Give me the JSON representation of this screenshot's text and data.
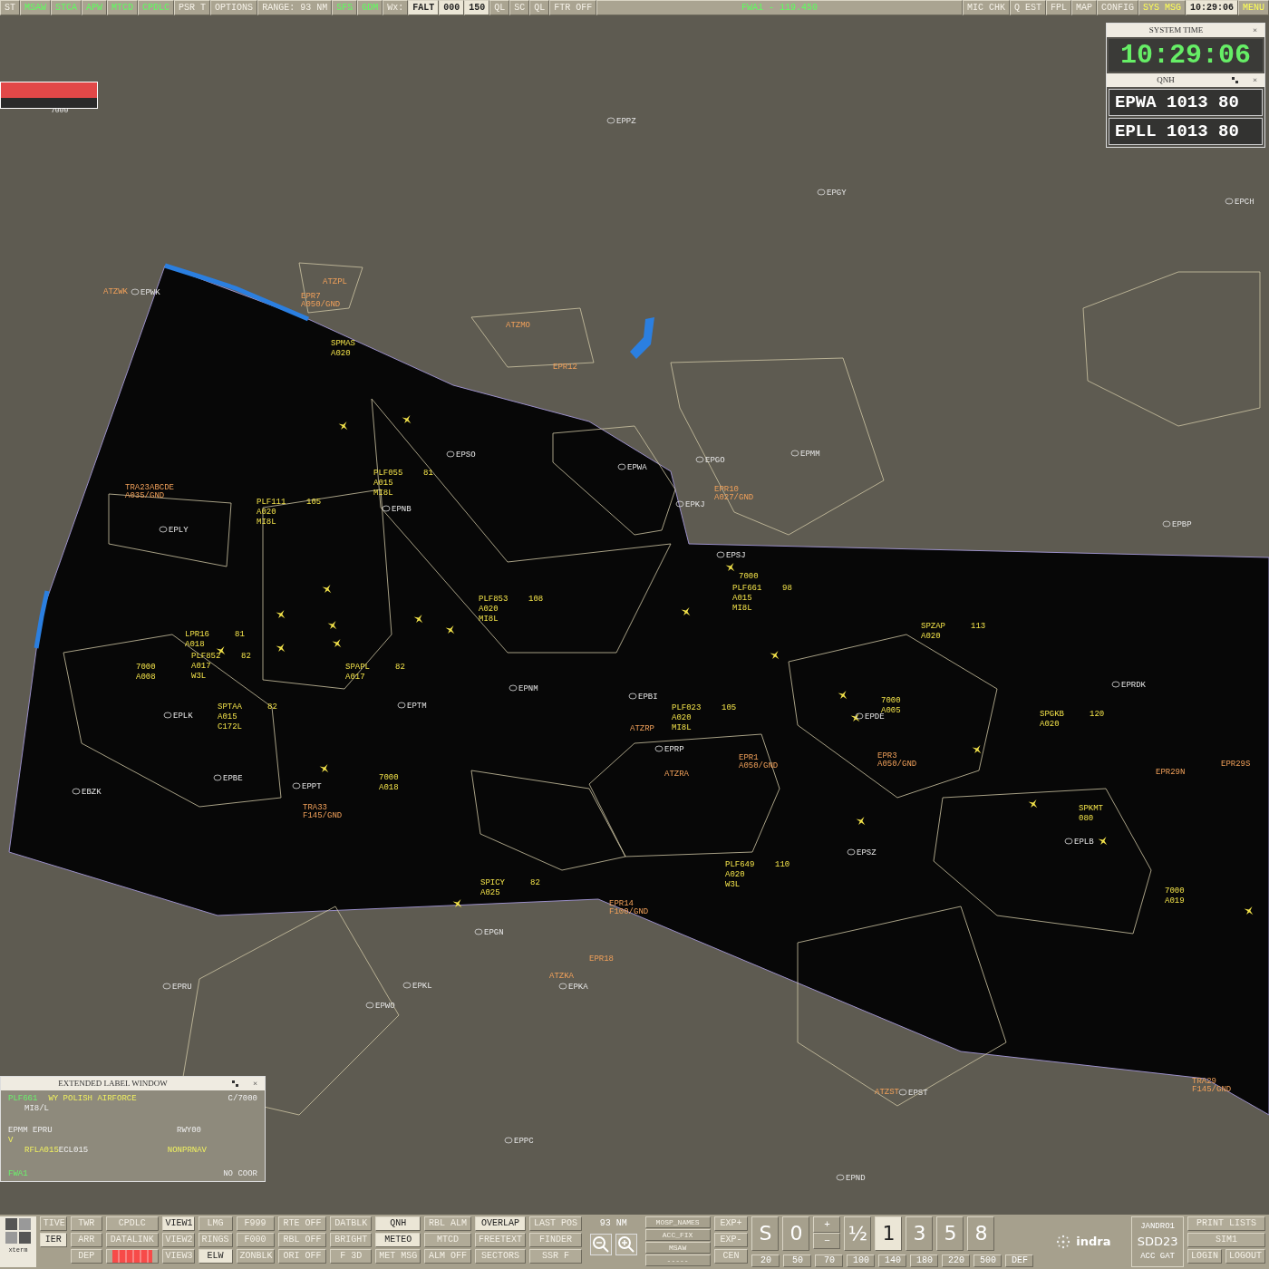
{
  "top_bar": [
    {
      "label": "ST",
      "kind": "plain"
    },
    {
      "label": "MSAW",
      "kind": "enabled"
    },
    {
      "label": "STCA",
      "kind": "enabled"
    },
    {
      "label": "APW",
      "kind": "enabled"
    },
    {
      "label": "MTCD",
      "kind": "enabled"
    },
    {
      "label": "CPDLC",
      "kind": "enabled"
    },
    {
      "label": "PSR T",
      "kind": "plain"
    },
    {
      "label": "OPTIONS",
      "kind": "plain"
    },
    {
      "label": "RANGE: 93 NM",
      "kind": "plain"
    },
    {
      "label": "SFS",
      "kind": "enabled"
    },
    {
      "label": "GDM",
      "kind": "enabled"
    },
    {
      "label": "Wx:",
      "kind": "plain"
    },
    {
      "label": "FALT",
      "kind": "pressed"
    },
    {
      "label": "000",
      "kind": "pressed"
    },
    {
      "label": "150",
      "kind": "pressed"
    },
    {
      "label": "QL",
      "kind": "plain"
    },
    {
      "label": "SC",
      "kind": "plain"
    },
    {
      "label": "QL",
      "kind": "plain"
    },
    {
      "label": "FTR OFF",
      "kind": "plain"
    },
    {
      "label": "FWA1 - 119.450",
      "kind": "frequency"
    },
    {
      "label": "MIC CHK",
      "kind": "plain"
    },
    {
      "label": "Q EST",
      "kind": "plain"
    },
    {
      "label": "FPL",
      "kind": "plain"
    },
    {
      "label": "MAP",
      "kind": "plain"
    },
    {
      "label": "CONFIG",
      "kind": "plain"
    },
    {
      "label": "SYS MSG",
      "kind": "warning"
    },
    {
      "label": "10:29:06",
      "kind": "pressed"
    },
    {
      "label": "MENU",
      "kind": "warning"
    }
  ],
  "alert_window": {
    "code": "7000"
  },
  "system_time": {
    "title": "SYSTEM TIME",
    "close": "×",
    "time": "10:29:06"
  },
  "qnh": {
    "title": "QNH",
    "close": "×",
    "rows": [
      "EPWA 1013 80",
      "EPLL 1013 80"
    ]
  },
  "map": {
    "tracks": [
      {
        "lines": [
          "SPMAS",
          "A020"
        ]
      },
      {
        "lines": [
          "PLF055",
          "A015",
          "MI8L"
        ],
        "speed": "81"
      },
      {
        "lines": [
          "PLF111",
          "A020",
          "MI8L"
        ],
        "speed": "105"
      },
      {
        "lines": [
          "PLF853",
          "A020",
          "MI8L"
        ],
        "speed": "108"
      },
      {
        "lines": [
          "LPR16",
          "A018"
        ],
        "speed": "81"
      },
      {
        "lines": [
          "PLF852",
          "A017",
          "W3L"
        ],
        "speed": "82"
      },
      {
        "lines": [
          "SPAPL",
          "A017"
        ],
        "speed": "82"
      },
      {
        "lines": [
          "SPTAA",
          "A015",
          "C172L"
        ],
        "speed": "82"
      },
      {
        "lines": [
          "7000",
          "A018"
        ]
      },
      {
        "lines": [
          "PLF023",
          "A020",
          "MI8L"
        ],
        "speed": "105"
      },
      {
        "lines": [
          "7000"
        ]
      },
      {
        "lines": [
          "PLF661",
          "A015",
          "MI8L"
        ],
        "speed": "98"
      },
      {
        "lines": [
          "SPZAP",
          "A020"
        ],
        "speed": "113"
      },
      {
        "lines": [
          "SPGKB",
          "A020"
        ],
        "speed": "120"
      },
      {
        "lines": [
          "7000",
          "A005"
        ]
      },
      {
        "lines": [
          "PLF649",
          "A020",
          "W3L"
        ],
        "speed": "110"
      },
      {
        "lines": [
          "SPICY",
          "A025"
        ],
        "speed": "82"
      },
      {
        "lines": [
          "SPKMT",
          "080"
        ]
      },
      {
        "lines": [
          "7000",
          "A019"
        ]
      },
      {
        "lines": [
          "7000",
          "A008"
        ]
      }
    ],
    "areas": [
      {
        "lines": [
          "TRA23ABCDE",
          "A035/GND"
        ]
      },
      {
        "lines": [
          "EPR10",
          "A027/GND"
        ]
      },
      {
        "lines": [
          "EPR14",
          "F100/GND"
        ]
      },
      {
        "lines": [
          "EPR18"
        ]
      },
      {
        "lines": [
          "ATZKA"
        ]
      },
      {
        "lines": [
          "EPR1",
          "A050/GND"
        ]
      },
      {
        "lines": [
          "EPR3",
          "A050/GND"
        ]
      },
      {
        "lines": [
          "TRA33",
          "F145/GND"
        ]
      },
      {
        "lines": [
          "ATZPL"
        ]
      },
      {
        "lines": [
          "ATZMO"
        ]
      },
      {
        "lines": [
          "EPR12"
        ]
      },
      {
        "lines": [
          "ATZRA"
        ]
      },
      {
        "lines": [
          "ATZRP"
        ]
      },
      {
        "lines": [
          "EPR7",
          "A050/GND"
        ]
      },
      {
        "lines": [
          "ATZWK"
        ]
      },
      {
        "lines": [
          "EPR29N"
        ]
      },
      {
        "lines": [
          "EPR29S"
        ]
      },
      {
        "lines": [
          "TRA29",
          "F145/GND"
        ]
      },
      {
        "lines": [
          "ATZST"
        ]
      }
    ],
    "places": [
      "EPPZ",
      "EPGY",
      "EPCH",
      "EPWK",
      "EPLY",
      "EPNB",
      "EPSO",
      "EPWA",
      "EPGO",
      "EPKJ",
      "EPSJ",
      "EPMM",
      "EPBP",
      "EPRDK",
      "EPNM",
      "EPBI",
      "EPRP",
      "EPTM",
      "EPLK",
      "EPBE",
      "EBZK",
      "EPPT",
      "EPDE",
      "EPKA",
      "EPGN",
      "EPRU",
      "EPKL",
      "EPWO",
      "EPPC",
      "EPND",
      "EPSZ",
      "EPLB",
      "EPST"
    ]
  },
  "elw": {
    "title": "EXTENDED LABEL WINDOW",
    "close": "×",
    "callsign": "PLF661",
    "operator": "WY POLISH AIRFORCE",
    "code": "C/7000",
    "type": "MI8/L",
    "route": "EPMM EPRU",
    "runway": "RWY00",
    "rules": "V",
    "rfl": "RFLA015",
    "ecl": "ECL015",
    "nav": "NONPRNAV",
    "sector": "FWA1",
    "coord": "NO COOR"
  },
  "bottom_bar": {
    "xterm": "xterm",
    "columns": [
      [
        {
          "label": "TIVE",
          "kind": "button",
          "pressed": false
        },
        {
          "label": "IER",
          "kind": "button",
          "pressed": true
        }
      ],
      [
        {
          "label": "TWR",
          "kind": "button",
          "pressed": false
        },
        {
          "label": "ARR",
          "kind": "button",
          "pressed": false
        },
        {
          "label": "DEP",
          "kind": "button",
          "pressed": false
        }
      ],
      [
        {
          "label": "CPDLC",
          "kind": "button",
          "pressed": false
        },
        {
          "label": "DATALINK",
          "kind": "button",
          "pressed": false
        },
        {
          "kind": "alarm",
          "pressed": false
        }
      ],
      [
        {
          "label": "VIEW1",
          "kind": "button",
          "pressed": true
        },
        {
          "label": "VIEW2",
          "kind": "button",
          "pressed": false
        },
        {
          "label": "VIEW3",
          "kind": "button",
          "pressed": false
        }
      ],
      [
        {
          "label": "LMG",
          "kind": "button",
          "pressed": false
        },
        {
          "label": "RINGS",
          "kind": "button",
          "pressed": false
        },
        {
          "label": "ELW",
          "kind": "button",
          "pressed": true
        }
      ],
      [
        {
          "label": "F999",
          "kind": "button",
          "pressed": false
        },
        {
          "label": "F000",
          "kind": "button",
          "pressed": false
        },
        {
          "label": "ZONBLK",
          "kind": "button",
          "pressed": false
        }
      ],
      [
        {
          "label": "RTE OFF",
          "kind": "button",
          "pressed": false
        },
        {
          "label": "RBL OFF",
          "kind": "button",
          "pressed": false
        },
        {
          "label": "ORI OFF",
          "kind": "button",
          "pressed": false
        }
      ],
      [
        {
          "label": "DATBLK",
          "kind": "button",
          "pressed": false
        },
        {
          "label": "BRIGHT",
          "kind": "button",
          "pressed": false
        },
        {
          "label": "F 3D",
          "kind": "button",
          "pressed": false
        }
      ],
      [
        {
          "label": "QNH",
          "kind": "button",
          "pressed": true
        },
        {
          "label": "METEO",
          "kind": "button",
          "pressed": true
        },
        {
          "label": "MET MSG",
          "kind": "button",
          "pressed": false
        }
      ],
      [
        {
          "label": "RBL ALM",
          "kind": "button",
          "pressed": false
        },
        {
          "label": "MTCD",
          "kind": "button",
          "pressed": false
        },
        {
          "label": "ALM OFF",
          "kind": "button",
          "pressed": false
        }
      ],
      [
        {
          "label": "OVERLAP",
          "kind": "button",
          "pressed": true
        },
        {
          "label": "FREETEXT",
          "kind": "button",
          "pressed": false
        },
        {
          "label": "SECTORS",
          "kind": "button",
          "pressed": false
        }
      ],
      [
        {
          "label": "LAST POS",
          "kind": "button",
          "pressed": false
        },
        {
          "label": "FINDER",
          "kind": "button",
          "pressed": false
        },
        {
          "label": "SSR F",
          "kind": "button",
          "pressed": false
        }
      ]
    ],
    "range": "93 NM",
    "lists": [
      "MOSP_NAMES",
      "ACC_FIX",
      "MSAW",
      "-----"
    ],
    "exp": [
      "EXP+",
      "EXP-",
      "CEN"
    ],
    "scale_keys": [
      {
        "label": "S",
        "kind": "key",
        "selected": false
      },
      {
        "label": "0",
        "kind": "key",
        "selected": false
      },
      {
        "label": "+",
        "label2": "−",
        "kind": "stack",
        "selected": false
      },
      {
        "label": "½",
        "kind": "key",
        "selected": false
      },
      {
        "label": "1",
        "kind": "key",
        "selected": true
      },
      {
        "label": "3",
        "kind": "key",
        "selected": false
      },
      {
        "label": "5",
        "kind": "key",
        "selected": false
      },
      {
        "label": "8",
        "kind": "key",
        "selected": false
      }
    ],
    "presets": [
      "20",
      "50",
      "70",
      "100",
      "140",
      "180",
      "220",
      "500",
      "DEF"
    ],
    "brand": "indra",
    "user": [
      "JANDRO1",
      "SDD23",
      "ACC GAT"
    ],
    "session": {
      "top": [
        "PRINT LISTS",
        "SIM1"
      ],
      "bottom": [
        "LOGIN",
        "LOGOUT"
      ]
    }
  }
}
